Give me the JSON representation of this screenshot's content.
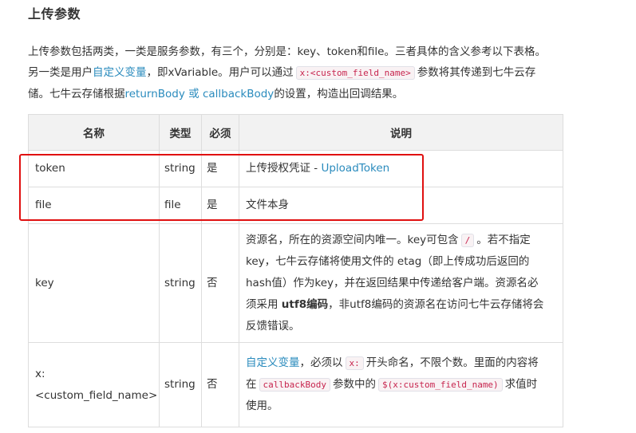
{
  "section": {
    "title": "上传参数"
  },
  "intro": {
    "line1": "上传参数包括两类，一类是服务参数，有三个，分别是：key、token和file。三者具体的含义参考以下表格。",
    "line2_a": "另一类是用户",
    "line2_link": "自定义变量",
    "line2_b": "，即xVariable。用户可以通过",
    "line2_code": "x:<custom_field_name>",
    "line2_c": "参数将其传递到七牛云存",
    "line3_a": "储。七牛云存储根据",
    "line3_link": "returnBody 或 callbackBody",
    "line3_b": "的设置，构造出回调结果。"
  },
  "table": {
    "headers": [
      "名称",
      "类型",
      "必须",
      "说明"
    ],
    "rows": [
      {
        "name": "token",
        "type": "string",
        "required": "是",
        "desc_text": "上传授权凭证 - ",
        "desc_link": "UploadToken"
      },
      {
        "name": "file",
        "type": "file",
        "required": "是",
        "desc_text": "文件本身"
      },
      {
        "name": "key",
        "type": "string",
        "required": "否",
        "desc_1a": "资源名，所在的资源空间内唯一。key可包含",
        "desc_1code": "/",
        "desc_1b": "。若不指定",
        "desc_2": "key，七牛云存储将使用文件的 etag（即上传成功后返回的",
        "desc_3": "hash值）作为key，并在返回结果中传递给客户端。资源名必",
        "desc_4a": "须采用 ",
        "desc_4bold": "utf8编码",
        "desc_4b": "，非utf8编码的资源名在访问七牛云存储将会",
        "desc_5": "反馈错误。"
      },
      {
        "name": "x:<custom_field_name>",
        "type": "string",
        "required": "否",
        "desc_1link": "自定义变量",
        "desc_1a": "，必须以",
        "desc_1code": "x:",
        "desc_1b": "开头命名，不限个数。里面的内容将",
        "desc_2a": "在",
        "desc_2code1": "callbackBody",
        "desc_2b": "参数中的",
        "desc_2code2": "$(x:custom_field_name)",
        "desc_2c": "求值时",
        "desc_3": "使用。"
      }
    ]
  },
  "annotation": {
    "highlight_color": "#e01010"
  },
  "colors": {
    "link": "#2a8bbd",
    "header_bg": "#f2f2f2",
    "code_text": "#c7254e"
  }
}
